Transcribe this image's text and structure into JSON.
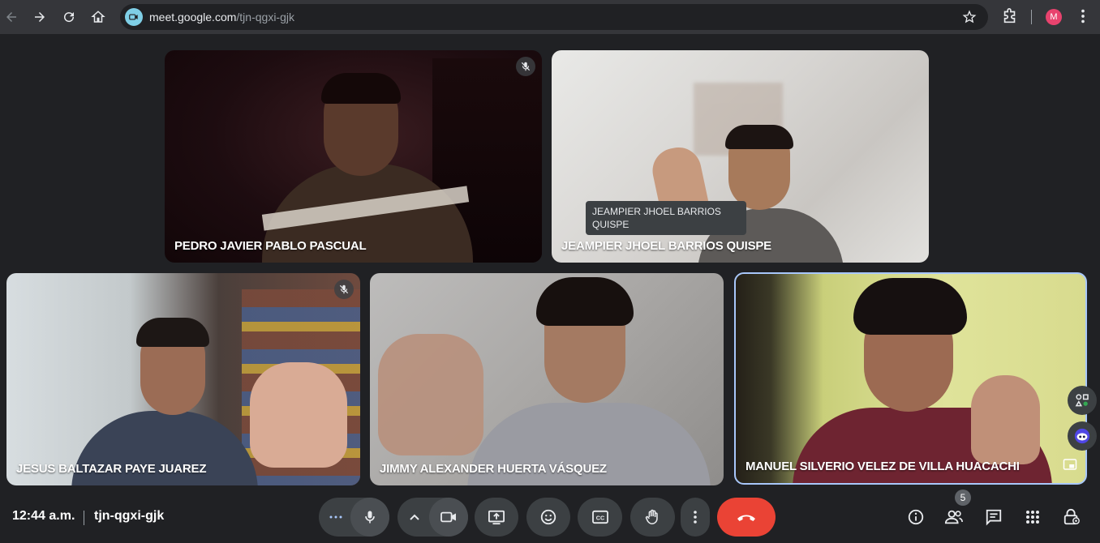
{
  "browser": {
    "url_host": "meet.google.com",
    "url_path": "/tjn-qgxi-gjk",
    "profile_initial": "M"
  },
  "tiles": [
    {
      "name": "PEDRO JAVIER PABLO PASCUAL",
      "muted": true
    },
    {
      "name": "JEAMPIER JHOEL BARRIOS QUISPE",
      "tooltip": "JEAMPIER JHOEL BARRIOS QUISPE",
      "muted": false
    },
    {
      "name": "JESUS BALTAZAR PAYE JUAREZ",
      "muted": true
    },
    {
      "name": "JIMMY ALEXANDER HUERTA VÁSQUEZ",
      "muted": false
    },
    {
      "name": "MANUEL SILVERIO VELEZ DE VILLA HUACACHI",
      "muted": false
    }
  ],
  "bottom_bar": {
    "time": "12:44 a.m.",
    "meeting_code": "tjn-qgxi-gjk",
    "participants_count": "5"
  },
  "colors": {
    "background": "#202124",
    "control": "#3c4043",
    "end_call": "#ea4335",
    "active_border": "#a8c7fa"
  }
}
